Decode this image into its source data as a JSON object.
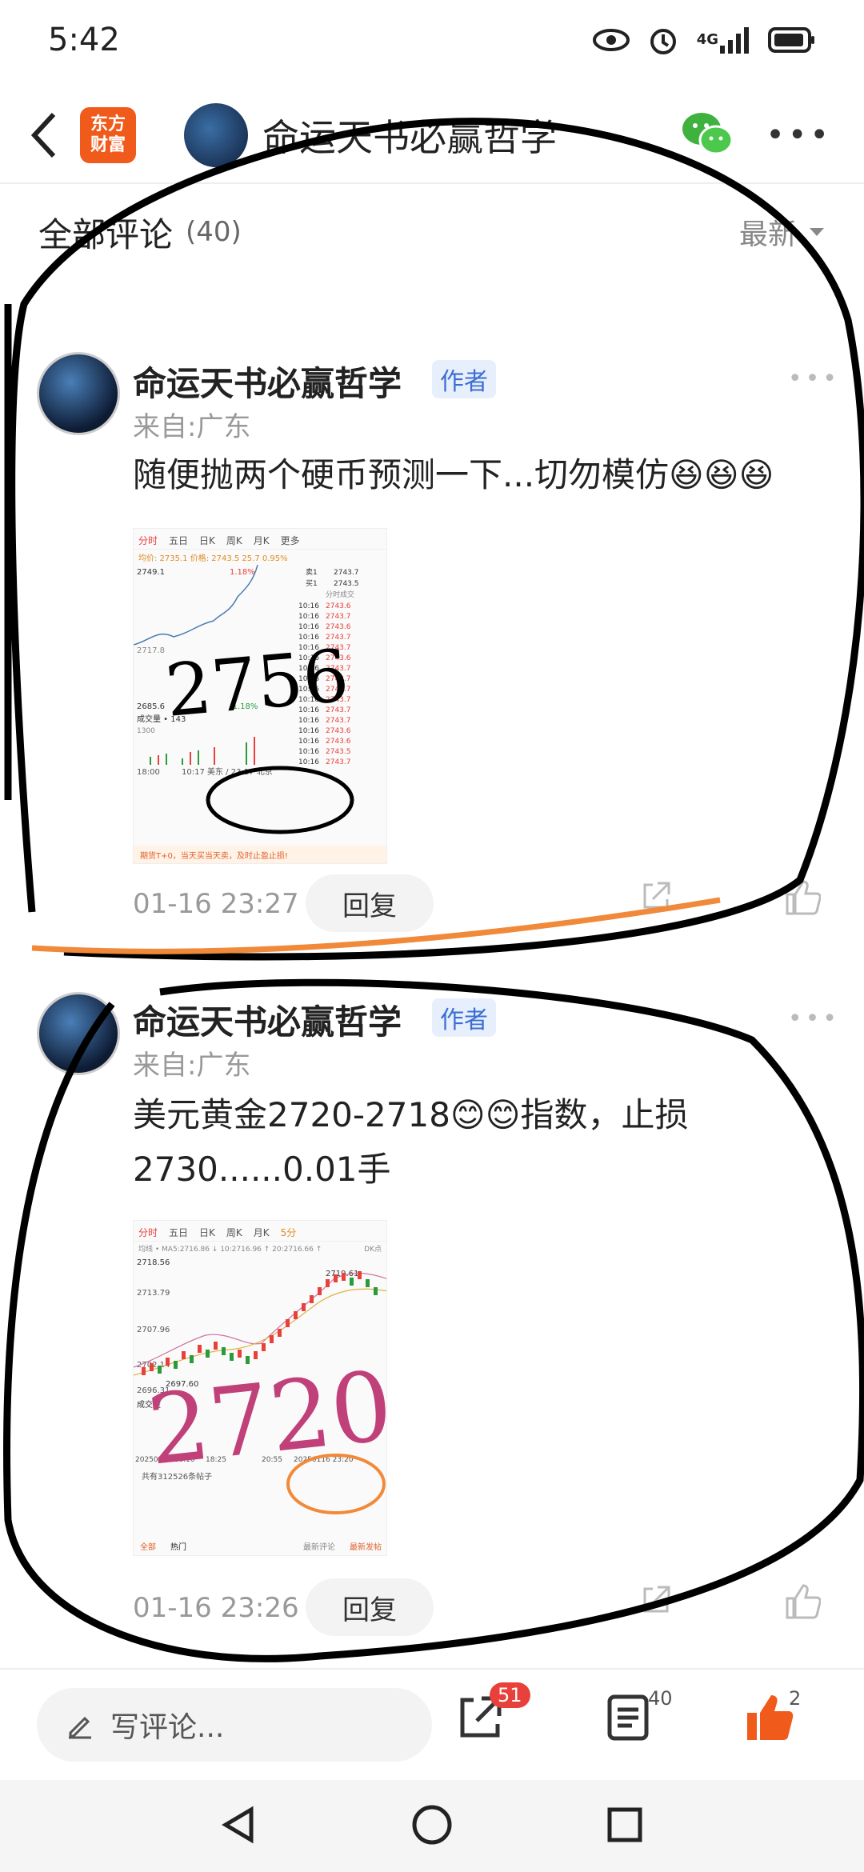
{
  "status": {
    "time": "5:42",
    "network": "4G"
  },
  "appbar": {
    "logo_text": "东方\n财富",
    "title": "命运天书必赢哲学"
  },
  "section": {
    "title": "全部评论",
    "count": "(40)",
    "sort": "最新"
  },
  "comments": [
    {
      "author": "命运天书必赢哲学",
      "badge": "作者",
      "location": "来自:广东",
      "text": "随便抛两个硬币预测一下...切勿模仿😆😆😆",
      "time": "01-16 23:27",
      "reply_label": "回复",
      "image": {
        "tabs": [
          "分时",
          "五日",
          "日K",
          "周K",
          "月K",
          "更多"
        ],
        "price_line": "均价: 2735.1 价格: 2743.5 25.7 0.95%",
        "high": "2749.1",
        "high_pct": "1.18%",
        "mid": "2717.8",
        "low": "2685.6",
        "low_pct": "-1.18%",
        "volume_label": "成交量 • 143",
        "vol_max": "1300",
        "x_start": "18:00",
        "x_end": "10:17 美东 / 23:17 北京",
        "footer": "期货T+0，当天买当天卖，及时止盈止损!",
        "sell1": "卖1",
        "sell1_val": "2743.7",
        "buy1": "买1",
        "buy1_val": "2743.5",
        "trades_title": "分时成交",
        "trades": [
          "2743.6",
          "2743.7",
          "2743.6",
          "2743.7",
          "2743.7",
          "2743.6",
          "2743.7",
          "2743.7",
          "2743.7",
          "2743.7",
          "2743.7",
          "2743.7",
          "2743.6",
          "2743.6",
          "2743.5",
          "2743.7"
        ],
        "trade_time": "10:16",
        "handwriting": "2756"
      }
    },
    {
      "author": "命运天书必赢哲学",
      "badge": "作者",
      "location": "来自:广东",
      "text": "美元黄金2720-2718😊😊指数，止损2730......0.01手",
      "time": "01-16 23:26",
      "reply_label": "回复",
      "image": {
        "tabs": [
          "分时",
          "五日",
          "日K",
          "周K",
          "月K",
          "5分"
        ],
        "ma_line": "均线 • MA5:2716.86 ↓ 10:2716.96 ↑ 20:2716.66 ↑",
        "high": "2718.56",
        "y_labels": [
          "2713.79",
          "2707.96",
          "2702.14",
          "2696.31"
        ],
        "peak": "2719.61",
        "low_mark": "2697.60",
        "volume_label": "成交量",
        "x_labels": [
          "20250116 16:10",
          "18:25",
          "20:55",
          "20250116 23:20"
        ],
        "footer": "共有312526条帖子",
        "tab_all": "全部",
        "tab_hot": "热门",
        "sort_new": "最新评论",
        "sort_post": "最新发帖",
        "corner": "DK点",
        "handwriting": "2720"
      }
    }
  ],
  "bottom": {
    "composer_placeholder": "写评论...",
    "share_count": "51",
    "comment_count": "40",
    "like_count": "2"
  },
  "colors": {
    "accent": "#f05a1a",
    "badge_blue": "#3a6ed6",
    "red": "#e8403a",
    "ink": "#000000",
    "orange_ink": "#f08a3a"
  }
}
